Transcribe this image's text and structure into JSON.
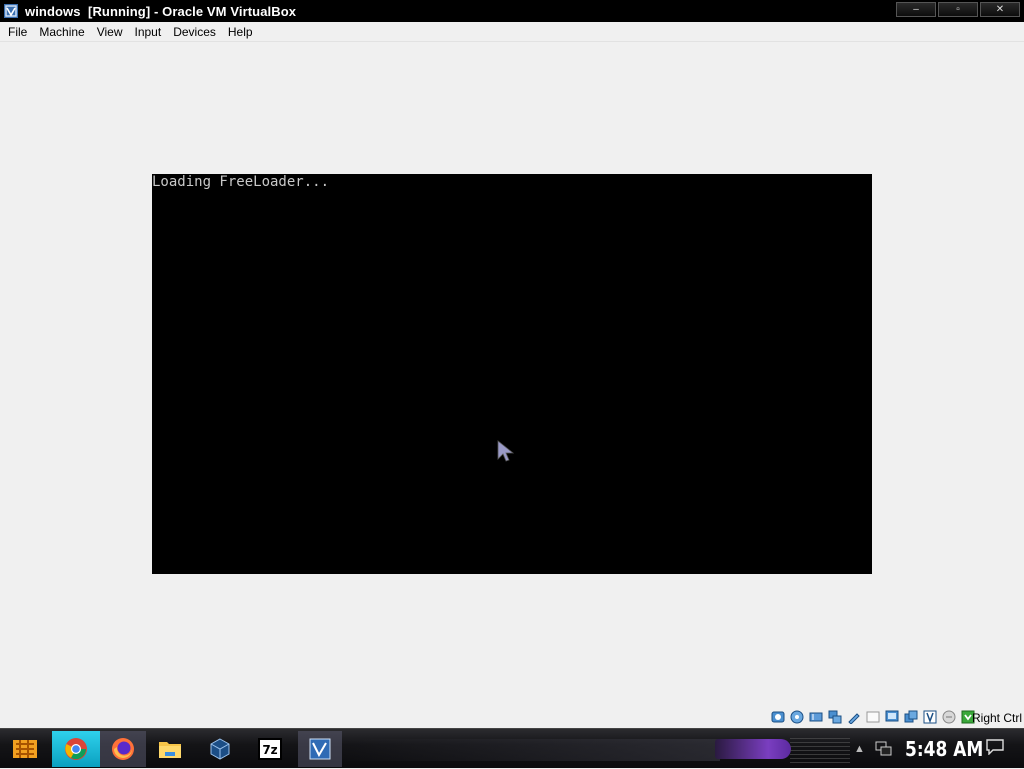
{
  "window": {
    "title": "windows  [Running] - Oracle VM VirtualBox",
    "buttons": {
      "minimize": "–",
      "maximize": "▫",
      "close": "✕"
    }
  },
  "menu": {
    "items": [
      "File",
      "Machine",
      "View",
      "Input",
      "Devices",
      "Help"
    ]
  },
  "vm": {
    "screen_text": "Loading FreeLoader..."
  },
  "statusbar": {
    "icons": [
      "hard-disk-icon",
      "optical-drive-icon",
      "audio-icon",
      "network-icon",
      "usb-icon",
      "shared-folder-icon",
      "display-icon",
      "video-capture-icon",
      "mouse-integration-icon",
      "cpu-icon",
      "hostkey-arrow-icon"
    ],
    "host_key": "Right Ctrl"
  },
  "taskbar": {
    "apps": [
      "start-button",
      "chrome",
      "firefox",
      "file-explorer",
      "virtualbox",
      "7zip",
      "virtualbox-vm"
    ],
    "clock": "5:48 AM",
    "accent": "#7a3ec0"
  }
}
